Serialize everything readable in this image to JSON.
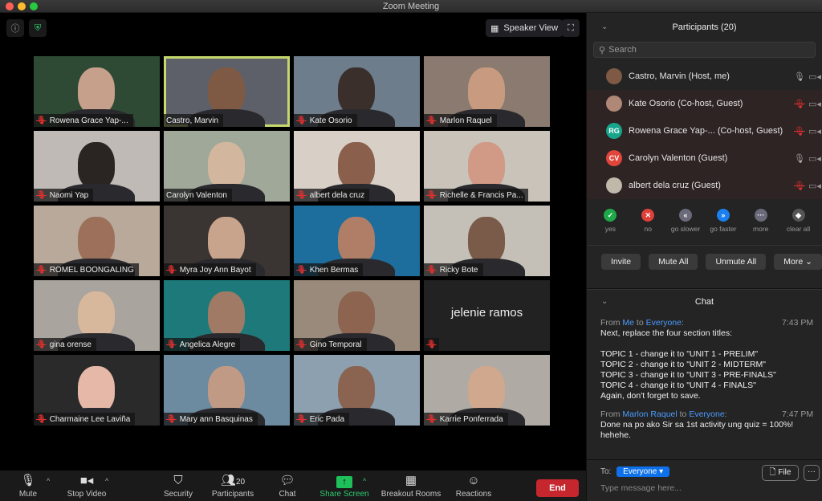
{
  "window": {
    "title": "Zoom Meeting"
  },
  "top": {
    "speaker_view_label": "Speaker View"
  },
  "tiles": [
    {
      "name": "Rowena Grace Yap-...",
      "muted": true,
      "bg": "#2f4a34",
      "face": "#c7a08c",
      "active": false
    },
    {
      "name": "Castro, Marvin",
      "muted": false,
      "bg": "#5d6068",
      "face": "#7e5a44",
      "active": true
    },
    {
      "name": "Kate Osorio",
      "muted": true,
      "bg": "#6e7d8c",
      "face": "#3a2f2b",
      "active": false
    },
    {
      "name": "Marlon Raquel",
      "muted": true,
      "bg": "#8a7a70",
      "face": "#c89a80",
      "active": false
    },
    {
      "name": "Naomi Yap",
      "muted": true,
      "bg": "#bfbab5",
      "face": "#2a2522",
      "active": false
    },
    {
      "name": "Carolyn Valenton",
      "muted": false,
      "bg": "#a0a89a",
      "face": "#d2b79e",
      "active": false
    },
    {
      "name": "albert dela cruz",
      "muted": true,
      "bg": "#d8cfc6",
      "face": "#8a5f4c",
      "active": false
    },
    {
      "name": "Richelle & Francis Pa...",
      "muted": true,
      "bg": "#c9c3ba",
      "face": "#d19a86",
      "active": false
    },
    {
      "name": "ROMEL BOONGALING",
      "muted": true,
      "bg": "#b8a99a",
      "face": "#9c705a",
      "active": false
    },
    {
      "name": "Myra Joy Ann Bayot",
      "muted": true,
      "bg": "#3a3432",
      "face": "#c9a48c",
      "active": false
    },
    {
      "name": "Khen Bermas",
      "muted": true,
      "bg": "#1d6e9c",
      "face": "#b07e66",
      "active": false
    },
    {
      "name": "Ricky Bote",
      "muted": true,
      "bg": "#c4c0b8",
      "face": "#7a5a48",
      "active": false
    },
    {
      "name": "gina orense",
      "muted": true,
      "bg": "#a9a49e",
      "face": "#d8b89c",
      "active": false
    },
    {
      "name": "Angelica Alegre",
      "muted": true,
      "bg": "#1e7a7a",
      "face": "#a07a64",
      "active": false
    },
    {
      "name": "Gino Temporal",
      "muted": true,
      "bg": "#9a8a7c",
      "face": "#8c6450",
      "active": false
    },
    {
      "name": "",
      "muted": true,
      "bg": "#222222",
      "face": "",
      "active": false,
      "no_video_name": "jelenie ramos"
    },
    {
      "name": "Charmaine Lee Laviña",
      "muted": true,
      "bg": "#2a2a2a",
      "face": "#e6b8a8",
      "active": false
    },
    {
      "name": "Mary ann Basquinas",
      "muted": true,
      "bg": "#6c8aa0",
      "face": "#c09a84",
      "active": false
    },
    {
      "name": "Eric Pada",
      "muted": true,
      "bg": "#8ca0b0",
      "face": "#8a6450",
      "active": false
    },
    {
      "name": "Karrie Ponferrada",
      "muted": true,
      "bg": "#b0aaa4",
      "face": "#d0a88e",
      "active": false
    }
  ],
  "toolbar": {
    "mute": "Mute",
    "stop_video": "Stop Video",
    "security": "Security",
    "participants": "Participants",
    "participants_count": "20",
    "chat": "Chat",
    "share_screen": "Share Screen",
    "breakout_rooms": "Breakout Rooms",
    "reactions": "Reactions",
    "end": "End"
  },
  "participants_panel": {
    "title": "Participants (20)",
    "search_placeholder": "Search",
    "list": [
      {
        "name": "Castro, Marvin (Host, me)",
        "initials": "",
        "avatar_color": "#7e5a44",
        "mic_muted": false,
        "guest": false
      },
      {
        "name": "Kate Osorio (Co-host, Guest)",
        "initials": "",
        "avatar_color": "#b08878",
        "mic_muted": true,
        "guest": true
      },
      {
        "name": "Rowena Grace Yap-...   (Co-host, Guest)",
        "initials": "RG",
        "avatar_color": "#17a58c",
        "mic_muted": true,
        "guest": true
      },
      {
        "name": "Carolyn Valenton (Guest)",
        "initials": "CV",
        "avatar_color": "#e0463b",
        "mic_muted": false,
        "guest": true
      },
      {
        "name": "albert dela cruz (Guest)",
        "initials": "",
        "avatar_color": "#c0b8a8",
        "mic_muted": true,
        "guest": true
      }
    ],
    "reactions": [
      {
        "label": "yes",
        "symbol": "✓",
        "color": "#1fa84a"
      },
      {
        "label": "no",
        "symbol": "✕",
        "color": "#e0403a"
      },
      {
        "label": "go slower",
        "symbol": "«",
        "color": "#6a6a7a"
      },
      {
        "label": "go faster",
        "symbol": "»",
        "color": "#1a7ff0"
      },
      {
        "label": "more",
        "symbol": "···",
        "color": "#6a6a7a"
      },
      {
        "label": "clear all",
        "symbol": "◆",
        "color": "#555555"
      }
    ],
    "buttons": {
      "invite": "Invite",
      "mute_all": "Mute All",
      "unmute_all": "Unmute All",
      "more": "More ⌄"
    }
  },
  "chat": {
    "title": "Chat",
    "messages": [
      {
        "from_prefix": "From ",
        "sender": "Me",
        "to_word": " to ",
        "recipient": "Everyone",
        "time": "7:43 PM",
        "text": "Next, replace the four section titles:\n\nTOPIC 1  - change it to \"UNIT 1 - PRELIM\"\nTOPIC 2 - change it to \"UNIT 2 - MIDTERM\"\nTOPIC 3 - change it to \"UNIT 3 - PRE-FINALS\"\nTOPIC 4 - change it to \"UNIT 4 - FINALS\"\nAgain, don't forget to save."
      },
      {
        "from_prefix": "From ",
        "sender": "Marlon Raquel",
        "to_word": " to ",
        "recipient": "Everyone",
        "time": "7:47 PM",
        "text": "Done na po ako Sir sa 1st activity ung quiz = 100%!\nhehehe."
      }
    ],
    "to_label": "To:",
    "to_value": "Everyone ▾",
    "file_label": "File",
    "more_label": "···",
    "input_placeholder": "Type message here..."
  }
}
